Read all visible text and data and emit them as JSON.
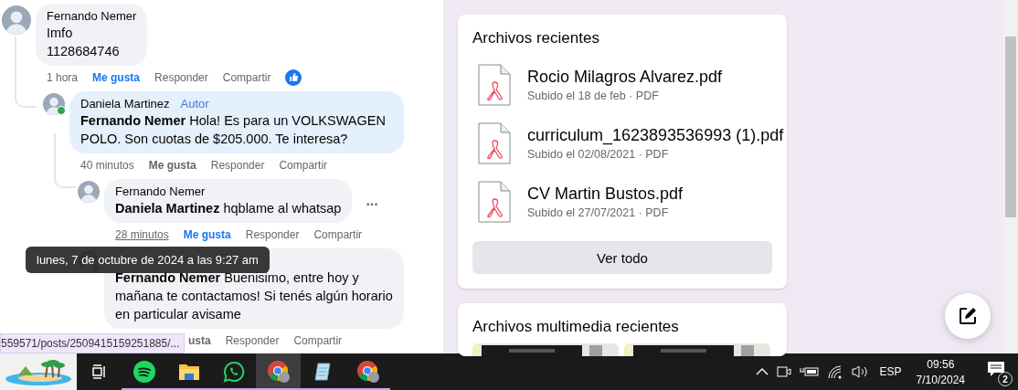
{
  "comments": [
    {
      "author": "Fernando Nemer",
      "highlighted": false,
      "lines": [
        "Imfo",
        "1128684746"
      ],
      "has_reaction": true,
      "actions": [
        {
          "kind": "time",
          "label": "1 hora",
          "hovered": false
        },
        {
          "kind": "like",
          "label": "Me gusta",
          "selected": true
        },
        {
          "kind": "reply",
          "label": "Responder"
        },
        {
          "kind": "share",
          "label": "Compartir"
        }
      ],
      "children": [
        {
          "author": "Daniela Martinez",
          "badge": "Autor",
          "online": true,
          "highlighted": true,
          "lines": [
            "**Fernando Nemer** Hola! Es para un VOLKSWAGEN POLO. Son cuotas de $205.000. Te interesa?"
          ],
          "actions": [
            {
              "kind": "time",
              "label": "40 minutos",
              "hovered": false
            },
            {
              "kind": "like",
              "label": "Me gusta",
              "selected": false
            },
            {
              "kind": "reply",
              "label": "Responder"
            },
            {
              "kind": "share",
              "label": "Compartir"
            }
          ],
          "children": [
            {
              "author": "Fernando Nemer",
              "highlighted": false,
              "more": "...",
              "lines": [
                "**Daniela Martinez** hqblame al whatsap"
              ],
              "actions": [
                {
                  "kind": "time",
                  "label": "28 minutos",
                  "hovered": true
                },
                {
                  "kind": "like",
                  "label": "Me gusta",
                  "selected": true
                },
                {
                  "kind": "reply",
                  "label": "Responder"
                },
                {
                  "kind": "share",
                  "label": "Compartir"
                }
              ]
            },
            {
              "online": true,
              "highlighted": false,
              "lines": [
                "**Fernando Nemer** Buenisimo, entre hoy y mañana te contactamos! Si tenés algún horario en particular avisame"
              ],
              "actions": [
                {
                  "kind": "cut",
                  "label": "usta"
                },
                {
                  "kind": "reply",
                  "label": "Responder"
                },
                {
                  "kind": "share",
                  "label": "Compartir"
                }
              ]
            }
          ]
        }
      ]
    }
  ],
  "tooltip": "lunes, 7 de octubre de 2024 a las 9:27 am",
  "status_url": "559571/posts/2509415159251885/...",
  "recent_files": {
    "title": "Archivos recientes",
    "files": [
      {
        "name": "Rocio Milagros Alvarez.pdf",
        "meta": "Subido el 18 de feb · PDF"
      },
      {
        "name": "curriculum_1623893536993 (1).pdf",
        "meta": "Subido el 02/08/2021 · PDF"
      },
      {
        "name": "CV Martin Bustos.pdf",
        "meta": "Subido el 27/07/2021 · PDF"
      }
    ],
    "button": "Ver todo"
  },
  "recent_media": {
    "title": "Archivos multimedia recientes"
  },
  "taskbar": {
    "apps": [
      {
        "kind": "taskview",
        "selected": false
      },
      {
        "kind": "music",
        "running": true,
        "selected": false
      },
      {
        "kind": "folder",
        "running": true,
        "selected": false
      },
      {
        "kind": "chat",
        "running": true,
        "selected": false
      },
      {
        "kind": "browser",
        "running": true,
        "selected": true
      },
      {
        "kind": "notepad",
        "running": true,
        "selected": false
      },
      {
        "kind": "browser",
        "running": true,
        "selected": false
      }
    ],
    "language": "ESP",
    "time": "09:56",
    "date": "7/10/2024",
    "notifications": "2"
  }
}
